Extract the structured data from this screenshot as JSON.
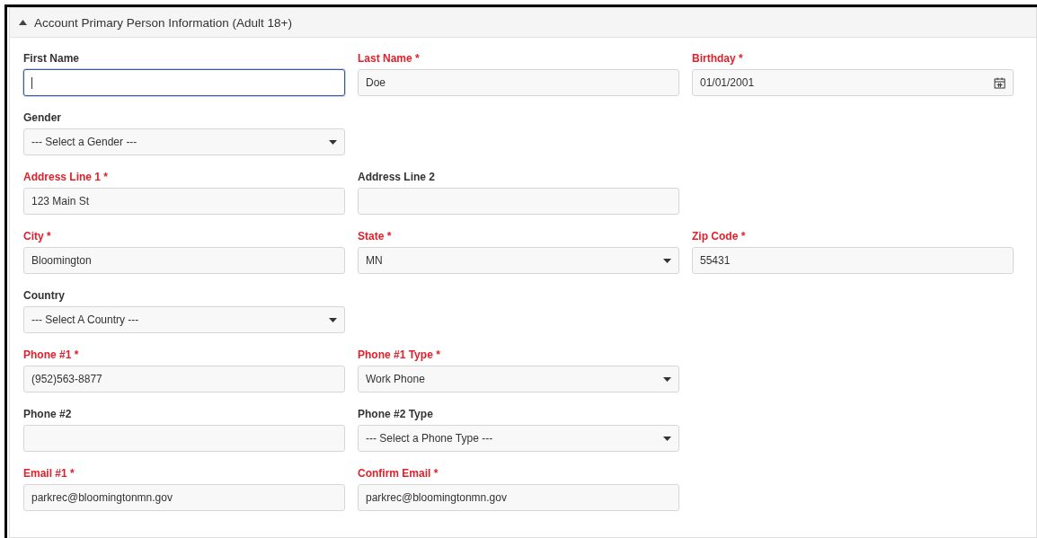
{
  "panel": {
    "title": "Account Primary Person Information (Adult 18+)",
    "expanded": true
  },
  "rows": [
    [
      {
        "label": "First Name",
        "required": false,
        "kind": "text",
        "focused": true
      },
      {
        "label": "Last Name *",
        "required": true,
        "kind": "text",
        "focused": false,
        "value": "Doe"
      },
      {
        "label": "Birthday *",
        "required": true,
        "kind": "date",
        "value": "01/01/2001"
      }
    ],
    [
      {
        "label": "Gender",
        "required": false,
        "kind": "select",
        "value": "--- Select a Gender ---"
      }
    ],
    [
      {
        "label": "Address Line 1 *",
        "required": true,
        "kind": "text",
        "focused": false,
        "value": "123 Main St"
      },
      {
        "label": "Address Line 2",
        "required": false,
        "kind": "text",
        "focused": false
      }
    ],
    [
      {
        "label": "City *",
        "required": true,
        "kind": "text",
        "focused": false,
        "value": "Bloomington"
      },
      {
        "label": "State *",
        "required": true,
        "kind": "select",
        "value": "MN"
      },
      {
        "label": "Zip Code *",
        "required": true,
        "kind": "text",
        "focused": false,
        "value": "55431"
      }
    ],
    [
      {
        "label": "Country",
        "required": false,
        "kind": "select",
        "value": "--- Select A Country ---"
      }
    ],
    [
      {
        "label": "Phone #1 *",
        "required": true,
        "kind": "text",
        "focused": false,
        "value": "(952)563-8877"
      },
      {
        "label": "Phone #1 Type *",
        "required": true,
        "kind": "select",
        "value": "Work Phone"
      }
    ],
    [
      {
        "label": "Phone #2",
        "required": false,
        "kind": "text",
        "focused": false
      },
      {
        "label": "Phone #2 Type",
        "required": false,
        "kind": "select",
        "value": "--- Select a Phone Type ---"
      }
    ],
    [
      {
        "label": "Email #1 *",
        "required": true,
        "kind": "text",
        "focused": false,
        "value": "parkrec@bloomingtonmn.gov"
      },
      {
        "label": "Confirm Email *",
        "required": true,
        "kind": "text",
        "focused": false,
        "value": "parkrec@bloomingtonmn.gov"
      }
    ]
  ]
}
